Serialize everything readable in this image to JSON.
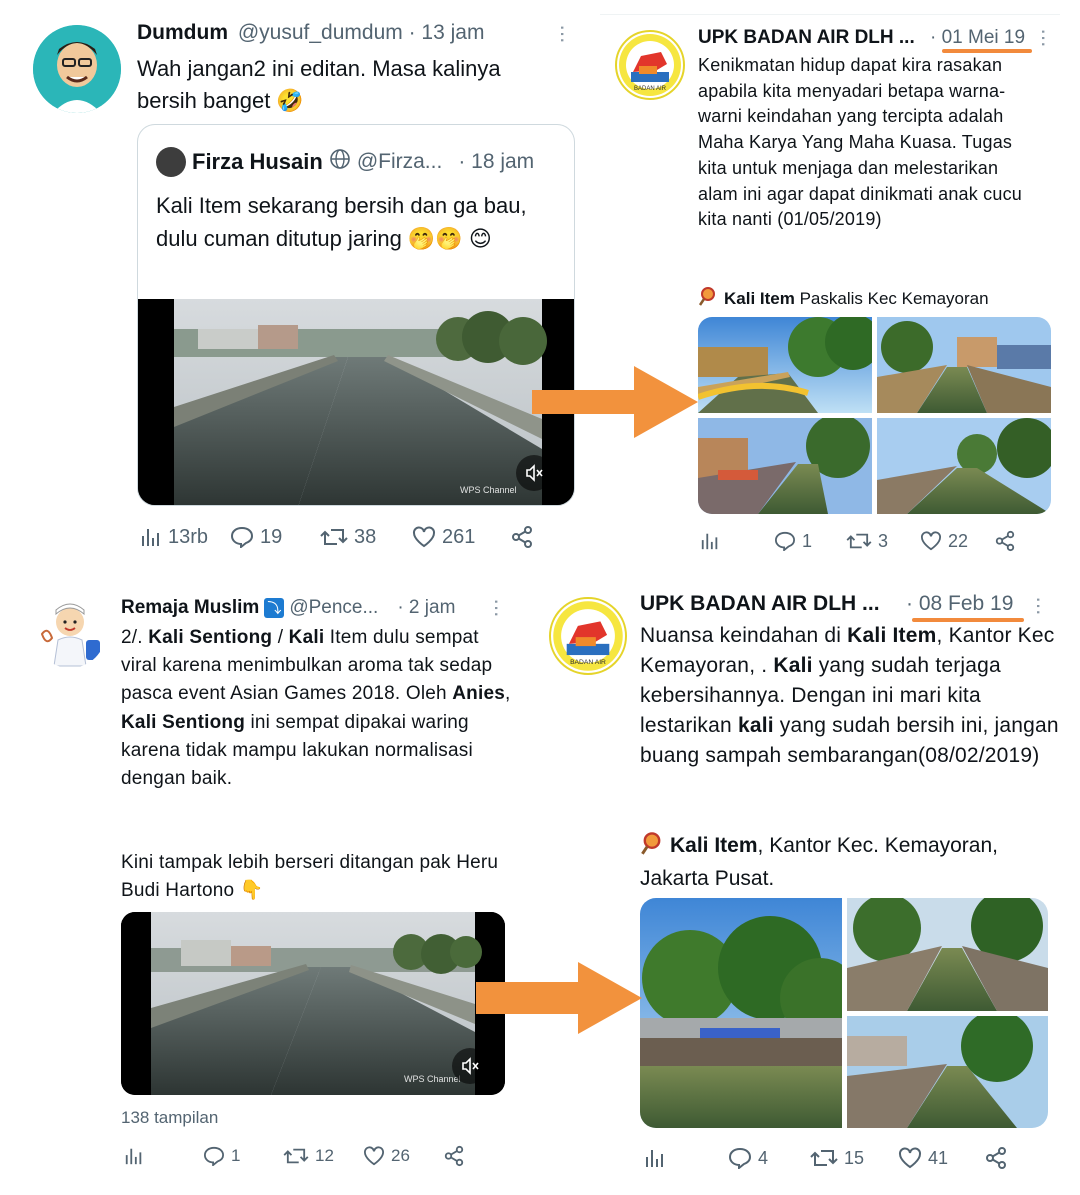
{
  "tweet1": {
    "name": "Dumdum",
    "handle": "@yusuf_dumdum",
    "time": "· 13 jam",
    "text": "Wah jangan2 ini editan. Masa kalinya bersih banget 🤣",
    "quote": {
      "name": "Firza Husain",
      "handle": "@Firza...",
      "time": "· 18 jam",
      "text": "Kali Item sekarang bersih dan ga bau, dulu cuman ditutup jaring 🤭🤭 😊",
      "watermark": "WPS Channel"
    },
    "stats": {
      "views": "13rb",
      "replies": "19",
      "retweets": "38",
      "likes": "261"
    }
  },
  "tweet2": {
    "name": "UPK BADAN AIR DLH ...",
    "time": "· 01 Mei 19",
    "text": "Kenikmatan hidup dapat kira rasakan apabila kita menyadari betapa warna-warni keindahan yang tercipta adalah Maha Karya Yang Maha Kuasa. Tugas kita untuk menjaga dan melestarikan alam ini agar dapat dinikmati anak cucu kita nanti (01/05/2019)",
    "location_bold": "Kali Item",
    "location_rest": " Paskalis Kec Kemayoran",
    "stats": {
      "replies": "1",
      "retweets": "3",
      "likes": "22"
    }
  },
  "tweet3": {
    "name": "Remaja Muslim",
    "handle": "@Pence...",
    "time": "· 2 jam",
    "line1_pre": "2/. ",
    "line1_b1": "Kali Sentiong",
    "line1_mid": " / ",
    "line1_b2": "Kali",
    "line1_post": " Item dulu",
    "body1": "sempat viral karena menimbulkan aroma tak sedap pasca event Asian Games 2018. Oleh",
    "anies": "Anies",
    "comma": ",",
    "sentiong2": "Kali Sentiong",
    "body2": " ini sempat dipakai waring karena tidak mampu lakukan normalisasi dengan baik.",
    "body3": "Kini tampak lebih berseri ditangan pak Heru Budi Hartono 👇",
    "watermark": "WPS Channel",
    "views": "138 tampilan",
    "stats": {
      "replies": "1",
      "retweets": "12",
      "likes": "26"
    }
  },
  "tweet4": {
    "name": "UPK BADAN AIR DLH ...",
    "time": "· 08 Feb 19",
    "p1": "Nuansa keindahan di",
    "p1b": "Kali Item",
    "p1c": ", Kantor Kec Kemayoran, .",
    "p1d": "Kali",
    "p1e": " yang sudah terjaga kebersihannya. Dengan ini mari kita lestarikan",
    "p1f": "kali",
    "p1g": " yang sudah bersih ini, jangan buang sampah sembarangan(08/02/2019)",
    "loc_b": "Kali Item",
    "loc_rest": ", Kantor Kec.  Kemayoran, Jakarta Pusat.",
    "stats": {
      "replies": "4",
      "retweets": "15",
      "likes": "41"
    }
  },
  "colors": {
    "accent_orange": "#f28a3c",
    "text": "#0f1419",
    "muted": "#536471"
  },
  "icons": [
    "views-icon",
    "reply-icon",
    "retweet-icon",
    "like-icon",
    "share-icon",
    "mute-icon",
    "location-pin-icon",
    "more-icon",
    "globe-icon",
    "verified-icon"
  ]
}
